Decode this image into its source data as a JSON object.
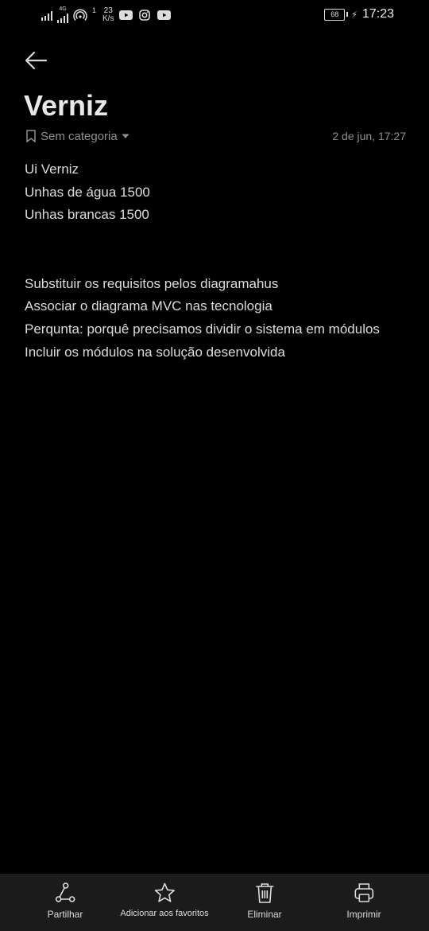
{
  "status_bar": {
    "network_type": "4G",
    "net_speed_value": "23",
    "net_speed_unit": "K/s",
    "hotspot_count": "1",
    "battery_level": "68",
    "time": "17:23"
  },
  "note": {
    "title": "Verniz",
    "category": "Sem categoria",
    "date": "2 de jun, 17:27",
    "lines_group1": [
      "Ui Verniz",
      "Unhas de água 1500",
      "Unhas brancas 1500"
    ],
    "lines_group2": [
      "Substituir os requisitos pelos diagramahus",
      "Associar o diagrama MVC nas tecnologia",
      "Perqunta: porquê precisamos dividir o sistema em módulos",
      "Incluir os módulos na solução desenvolvida"
    ]
  },
  "actions": {
    "share": "Partilhar",
    "favorite": "Adicionar aos favoritos",
    "delete": "Eliminar",
    "print": "Imprimir"
  },
  "colors": {
    "background": "#000000",
    "bottom_bar": "#1b1b1b",
    "text": "#dcdcdc",
    "muted": "#8f8f8f"
  }
}
